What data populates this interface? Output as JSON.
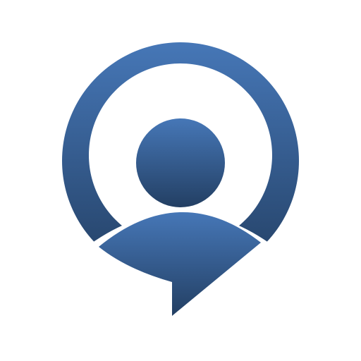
{
  "icon": {
    "name": "user-chat-bubble-icon",
    "colors": {
      "gradient_top": "#4677B7",
      "gradient_bottom": "#233F63",
      "background": "#FFFFFF"
    }
  }
}
